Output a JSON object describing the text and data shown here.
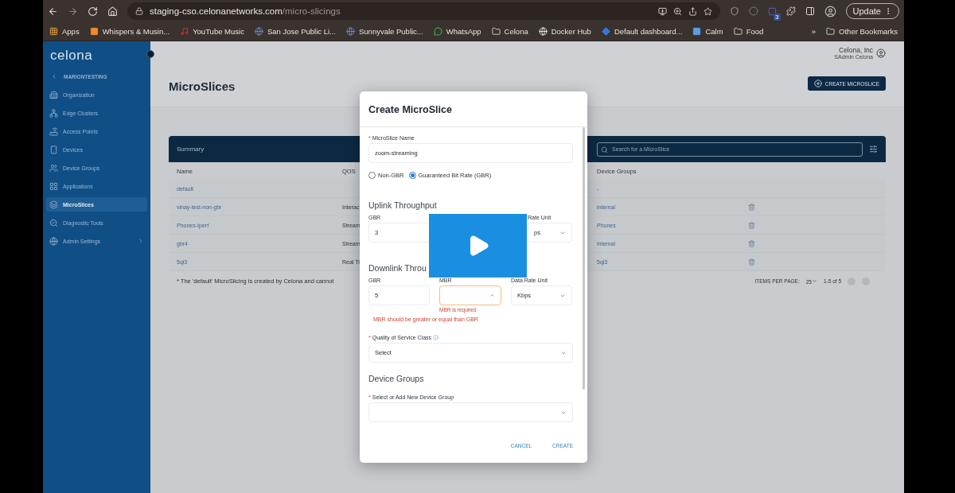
{
  "browser": {
    "url_host": "staging-cso.celonanetworks.com",
    "url_path": "/micro-slicings",
    "extensions_badge": "3",
    "update_button": "Update",
    "bookmarks": [
      {
        "kind": "apps",
        "label": "Apps"
      },
      {
        "kind": "blog",
        "label": "Whispers & Musin..."
      },
      {
        "kind": "music",
        "label": "YouTube Music"
      },
      {
        "kind": "globe",
        "label": "San Jose Public Li..."
      },
      {
        "kind": "globe",
        "label": "Sunnyvale Public..."
      },
      {
        "kind": "chat",
        "label": "WhatsApp"
      },
      {
        "kind": "folder",
        "label": "Celona"
      },
      {
        "kind": "site",
        "label": "Docker Hub"
      },
      {
        "kind": "dashboard",
        "label": "Default dashboard..."
      },
      {
        "kind": "calm",
        "label": "Calm"
      },
      {
        "kind": "folder",
        "label": "Food"
      }
    ],
    "more": "»",
    "other_bookmarks": "Other Bookmarks"
  },
  "sidebar": {
    "logo": "celona",
    "org": "MARIONTESTING",
    "items": [
      {
        "kind": "building",
        "label": "Organization",
        "selected": false
      },
      {
        "kind": "cluster",
        "label": "Edge Clusters",
        "selected": false
      },
      {
        "kind": "router",
        "label": "Access Points",
        "selected": false
      },
      {
        "kind": "device",
        "label": "Devices",
        "selected": false
      },
      {
        "kind": "group",
        "label": "Device Groups",
        "selected": false
      },
      {
        "kind": "grid",
        "label": "Applications",
        "selected": false
      },
      {
        "kind": "layers",
        "label": "MicroSlices",
        "selected": true
      },
      {
        "kind": "diagnostic",
        "label": "Diagnostic Tools",
        "selected": false
      },
      {
        "kind": "globe",
        "label": "Admin Settings",
        "selected": false,
        "expandable": true
      }
    ]
  },
  "header": {
    "title": "MicroSlices",
    "company": "Celona, Inc",
    "user": "SAdmin Celona",
    "create_button": "CREATE MICROSLICE"
  },
  "table": {
    "title": "Summary",
    "search_placeholder": "Search for a MicroSlice",
    "columns": [
      "Name",
      "QOS",
      "Device Groups"
    ],
    "rows": [
      {
        "name": "default",
        "qos": "",
        "device_groups": "-",
        "deletable": false
      },
      {
        "name": "vinay-test-non-gbr",
        "qos": "Interac",
        "device_groups": "internal",
        "deletable": true
      },
      {
        "name": "Phones-Iperf",
        "qos": "Stream",
        "device_groups": "Phones",
        "deletable": true
      },
      {
        "name": "gbr4",
        "qos": "Stream",
        "device_groups": "internal",
        "deletable": true
      },
      {
        "name": "5qi3",
        "qos": "Real Ti",
        "device_groups": "5qi3",
        "deletable": true
      }
    ],
    "note": "* The 'default' MicroSlicing is created by Celona and cannot",
    "items_per_page_label": "ITEMS PER PAGE:",
    "items_per_page": "25",
    "range": "1-5 of 5"
  },
  "modal": {
    "title": "Create MicroSlice",
    "required_mark": "*",
    "name_label": "MicroSlice Name",
    "name_value": "zoom-streaming",
    "radios": [
      {
        "label": "Non-GBR",
        "selected": false
      },
      {
        "label": "Guaranteed Bit Rate (GBR)",
        "selected": true
      }
    ],
    "uplink": {
      "heading": "Uplink Throughput",
      "gbr_label": "GBR",
      "gbr_value": "3",
      "unit_label": "Rate Unit",
      "unit_value": "ps"
    },
    "downlink": {
      "heading": "Downlink Throu",
      "gbr_label": "GBR",
      "gbr_value": "5",
      "mbr_label": "MBR",
      "mbr_error": "MBR is required",
      "unit_label": "Data Rate Unit",
      "unit_value": "Kbps",
      "error": "MBR should be greater or equal than GBR"
    },
    "qos_label": "Quality of Service Class",
    "qos_value": "Select",
    "groups_heading": "Device Groups",
    "groups_label": "Select or Add New Device Group",
    "buttons": [
      "CANCEL",
      "CREATE"
    ]
  }
}
